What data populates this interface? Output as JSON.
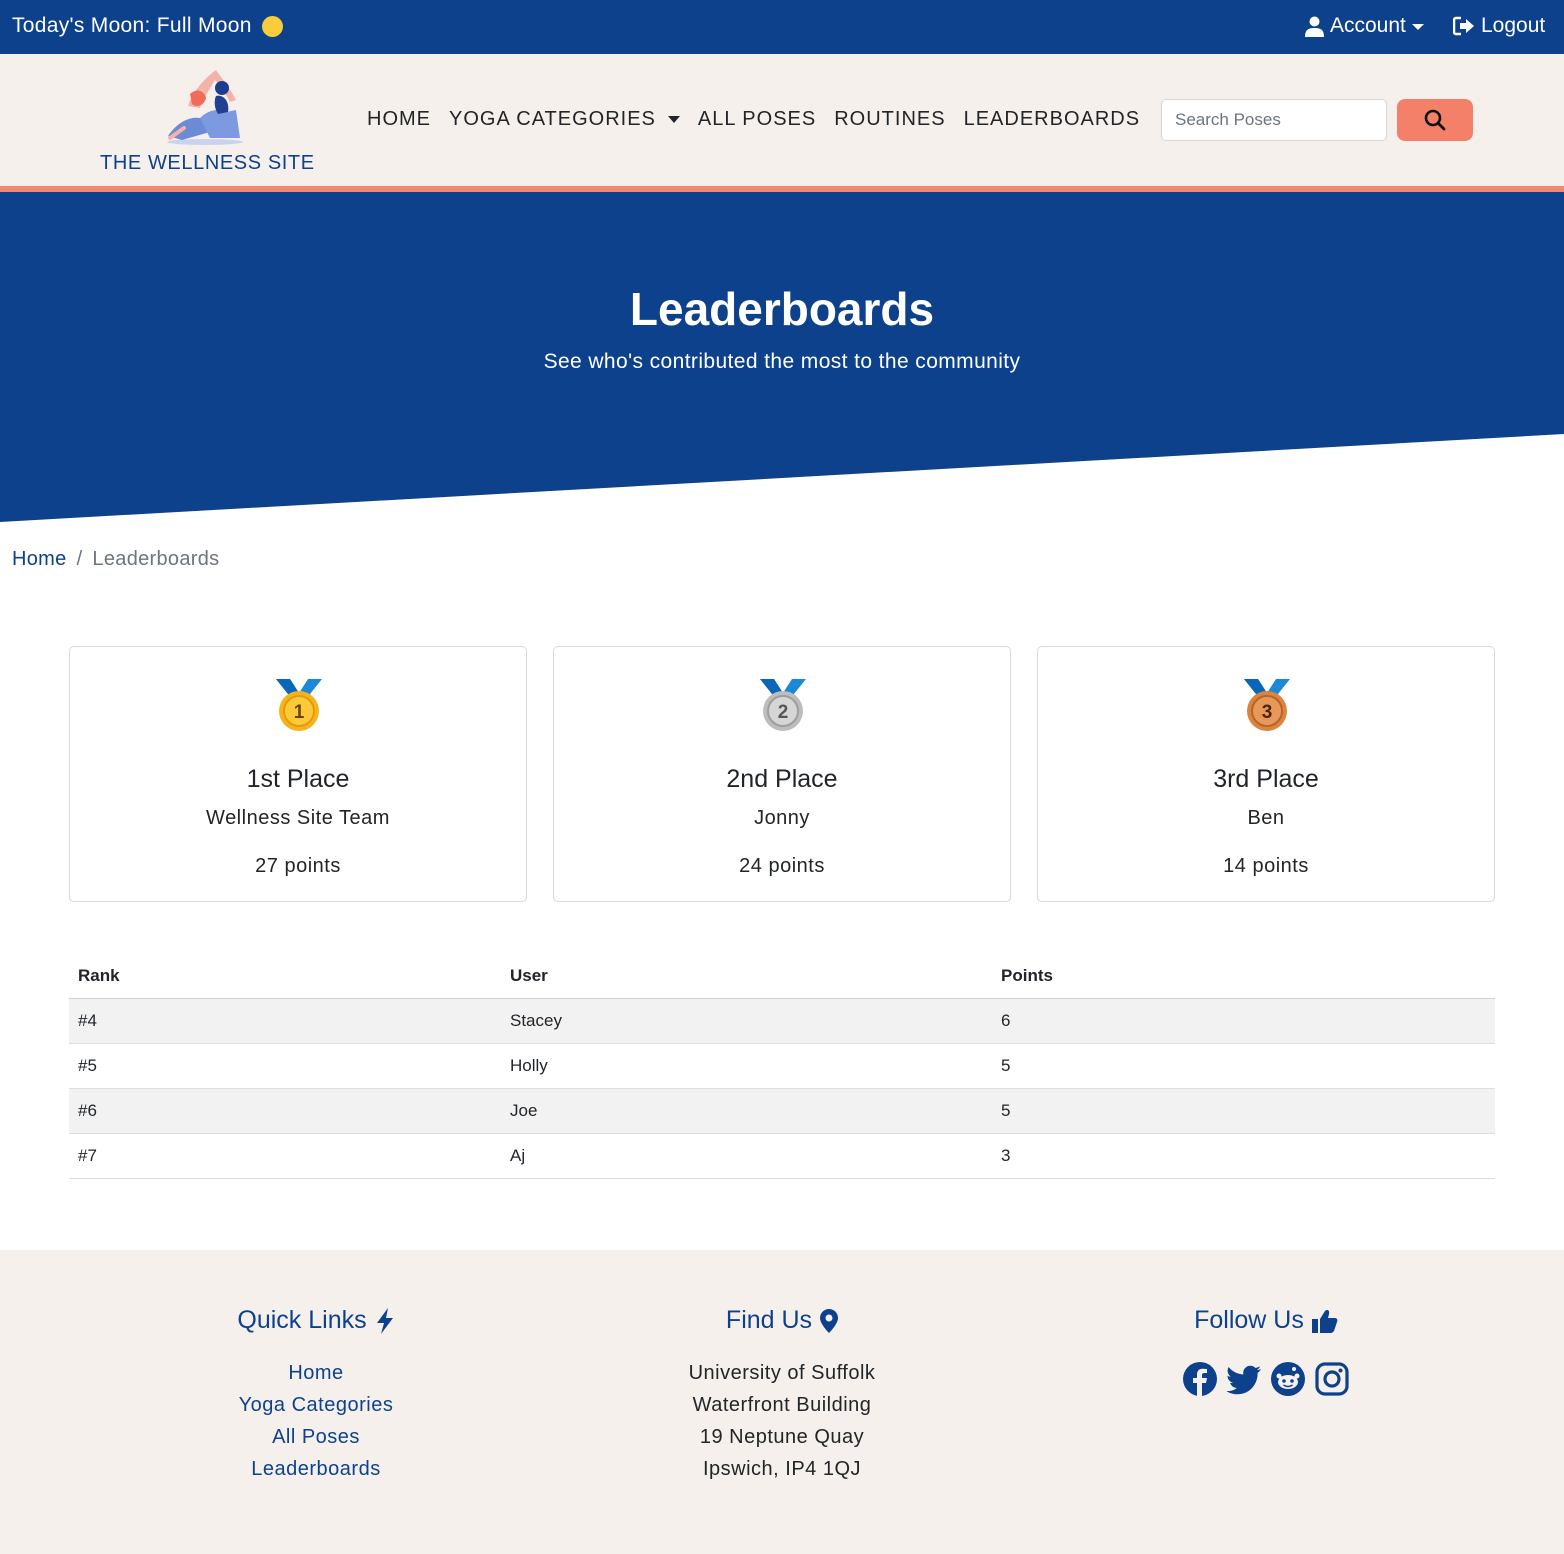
{
  "topbar": {
    "moon_text": "Today's Moon: Full Moon",
    "moon_icon": "full-moon-icon",
    "account_label": "Account",
    "logout_label": "Logout"
  },
  "brand": {
    "name": "THE WELLNESS SITE",
    "logo_icon": "yoga-woman-logo"
  },
  "nav": {
    "items": [
      {
        "label": "HOME"
      },
      {
        "label": "YOGA CATEGORIES",
        "has_dropdown": true
      },
      {
        "label": "ALL POSES"
      },
      {
        "label": "ROUTINES"
      },
      {
        "label": "LEADERBOARDS"
      }
    ],
    "search_placeholder": "Search Poses",
    "search_icon": "magnifier-icon"
  },
  "hero": {
    "title": "Leaderboards",
    "subtitle": "See who's contributed the most to the community"
  },
  "breadcrumb": {
    "home": "Home",
    "separator": "/",
    "current": "Leaderboards"
  },
  "podium": [
    {
      "place": "1st Place",
      "name": "Wellness Site Team",
      "points": "27 points",
      "medal_number": "1",
      "medal_color": "#f5b41c"
    },
    {
      "place": "2nd Place",
      "name": "Jonny",
      "points": "24 points",
      "medal_number": "2",
      "medal_color": "#bdbdbd"
    },
    {
      "place": "3rd Place",
      "name": "Ben",
      "points": "14 points",
      "medal_number": "3",
      "medal_color": "#d9843f"
    }
  ],
  "table": {
    "headers": [
      "Rank",
      "User",
      "Points"
    ],
    "rows": [
      [
        "#4",
        "Stacey",
        "6"
      ],
      [
        "#5",
        "Holly",
        "5"
      ],
      [
        "#6",
        "Joe",
        "5"
      ],
      [
        "#7",
        "Aj",
        "3"
      ]
    ]
  },
  "footer": {
    "quick_links_title": "Quick Links",
    "quick_links": [
      "Home",
      "Yoga Categories",
      "All Poses",
      "Leaderboards"
    ],
    "find_us_title": "Find Us",
    "address": [
      "University of Suffolk",
      "Waterfront Building",
      "19 Neptune Quay",
      "Ipswich, IP4 1QJ"
    ],
    "follow_us_title": "Follow Us",
    "socials": [
      "facebook-icon",
      "twitter-icon",
      "reddit-icon",
      "instagram-icon"
    ]
  },
  "colors": {
    "primary": "#0d418c",
    "accent": "#f5806a",
    "cream": "#f6f0ed"
  }
}
